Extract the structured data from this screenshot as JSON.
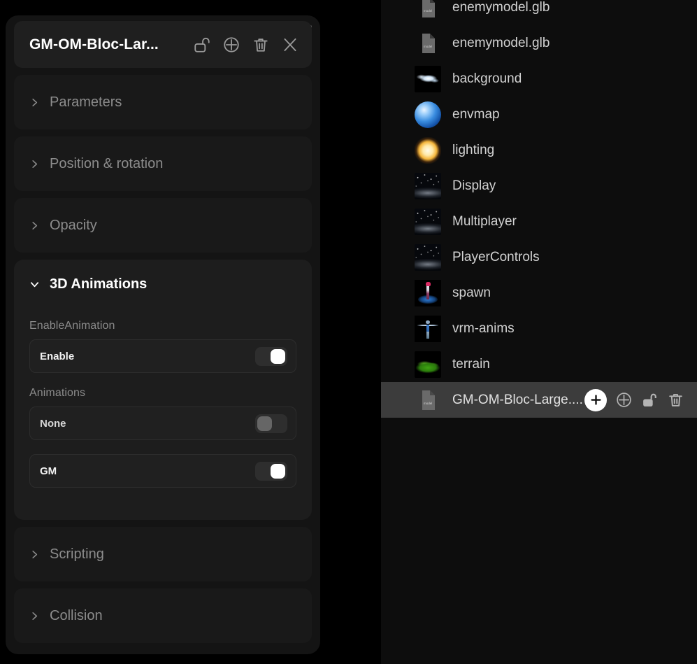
{
  "inspector": {
    "title": "GM-OM-Bloc-Lar...",
    "header_icons": [
      {
        "name": "unlock-icon",
        "label": "Unlock"
      },
      {
        "name": "focus-target-icon",
        "label": "Focus"
      },
      {
        "name": "trash-icon",
        "label": "Delete"
      },
      {
        "name": "close-icon",
        "label": "Close"
      }
    ],
    "sections": [
      {
        "label": "Parameters",
        "open": false
      },
      {
        "label": "Position & rotation",
        "open": false
      },
      {
        "label": "Opacity",
        "open": false
      },
      {
        "label": "3D Animations",
        "open": true
      },
      {
        "label": "Scripting",
        "open": false
      },
      {
        "label": "Collision",
        "open": false
      }
    ],
    "animations_panel": {
      "title": "3D Animations",
      "groups": [
        {
          "label": "EnableAnimation",
          "rows": [
            {
              "name": "Enable",
              "toggle": true
            }
          ]
        },
        {
          "label": "Animations",
          "rows": [
            {
              "name": "None",
              "toggle": false
            },
            {
              "name": "GM",
              "toggle": true
            }
          ]
        }
      ]
    },
    "drag_handle": "drag-handle-icon"
  },
  "sidebar": {
    "items": [
      {
        "name": "enemymodel.glb",
        "icon": "model-file-icon",
        "selected": false
      },
      {
        "name": "enemymodel.glb",
        "icon": "model-file-icon",
        "selected": false
      },
      {
        "name": "background",
        "icon": "background-thumbnail",
        "selected": false
      },
      {
        "name": "envmap",
        "icon": "globe-thumbnail",
        "selected": false
      },
      {
        "name": "lighting",
        "icon": "sun-thumbnail",
        "selected": false
      },
      {
        "name": "Display",
        "icon": "scene-thumbnail",
        "selected": false
      },
      {
        "name": "Multiplayer",
        "icon": "scene-thumbnail",
        "selected": false
      },
      {
        "name": "PlayerControls",
        "icon": "scene-thumbnail",
        "selected": false
      },
      {
        "name": "spawn",
        "icon": "avatar-thumbnail",
        "selected": false
      },
      {
        "name": "vrm-anims",
        "icon": "rig-thumbnail",
        "selected": false
      },
      {
        "name": "terrain",
        "icon": "terrain-thumbnail",
        "selected": false
      },
      {
        "name": "GM-OM-Bloc-Large....",
        "icon": "model-file-icon",
        "selected": true
      }
    ],
    "selected_row_actions": [
      {
        "name": "add-button",
        "label": "+"
      },
      {
        "name": "focus-target-icon",
        "label": "Focus"
      },
      {
        "name": "unlock-icon",
        "label": "Unlock"
      },
      {
        "name": "trash-icon",
        "label": "Delete"
      }
    ]
  },
  "colors": {
    "page_background": "#000000",
    "panel_background": "#141414",
    "card_background": "#191919",
    "card_open_background": "#1d1d1d",
    "row_background": "#202020",
    "selected_row": "#3c3c3c",
    "accent_white": "#ffffff",
    "text_primary": "#ffffff",
    "text_muted": "#8c8c8c",
    "sidebar_background": "#0d0d0d"
  }
}
